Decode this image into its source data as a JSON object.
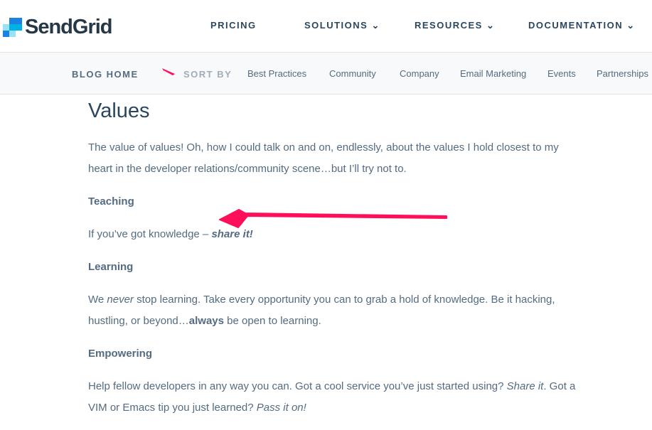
{
  "header": {
    "logo": "SendGrid",
    "nav": [
      {
        "label": "PRICING"
      },
      {
        "label": "SOLUTIONS"
      },
      {
        "label": "RESOURCES"
      },
      {
        "label": "DOCUMENTATION"
      }
    ]
  },
  "subnav": {
    "blog_home": "BLOG HOME",
    "sort_by": "SORT BY",
    "categories": [
      "Best Practices",
      "Community",
      "Company",
      "Email Marketing",
      "Events",
      "Partnerships"
    ]
  },
  "article": {
    "title": "Values",
    "intro": "The value of values! Oh, how I could talk on and on, endlessly, about the values I hold closest to my heart in the developer relations/community scene…but I’ll try not to.",
    "sections": [
      {
        "heading": "Teaching",
        "text_a": "If you’ve got knowledge – ",
        "em_bold": "share it!"
      },
      {
        "heading": "Learning",
        "text_a": "We ",
        "em": "never",
        "text_b": " stop learning. Take every opportunity you can to grab a hold of knowledge. Be it hacking, hustling, or beyond…",
        "bold": "always",
        "text_c": " be open to learning."
      },
      {
        "heading": "Empowering",
        "text_a": "Help fellow developers in any way you can. Got a cool service you’ve just started using? ",
        "em": "Share it",
        "text_b": ". Got a VIM or Emacs tip you just learned? ",
        "em2": "Pass it on!"
      }
    ]
  },
  "colors": {
    "annotation_arrow": "#ff0f5a",
    "brand_dark": "#263746"
  }
}
